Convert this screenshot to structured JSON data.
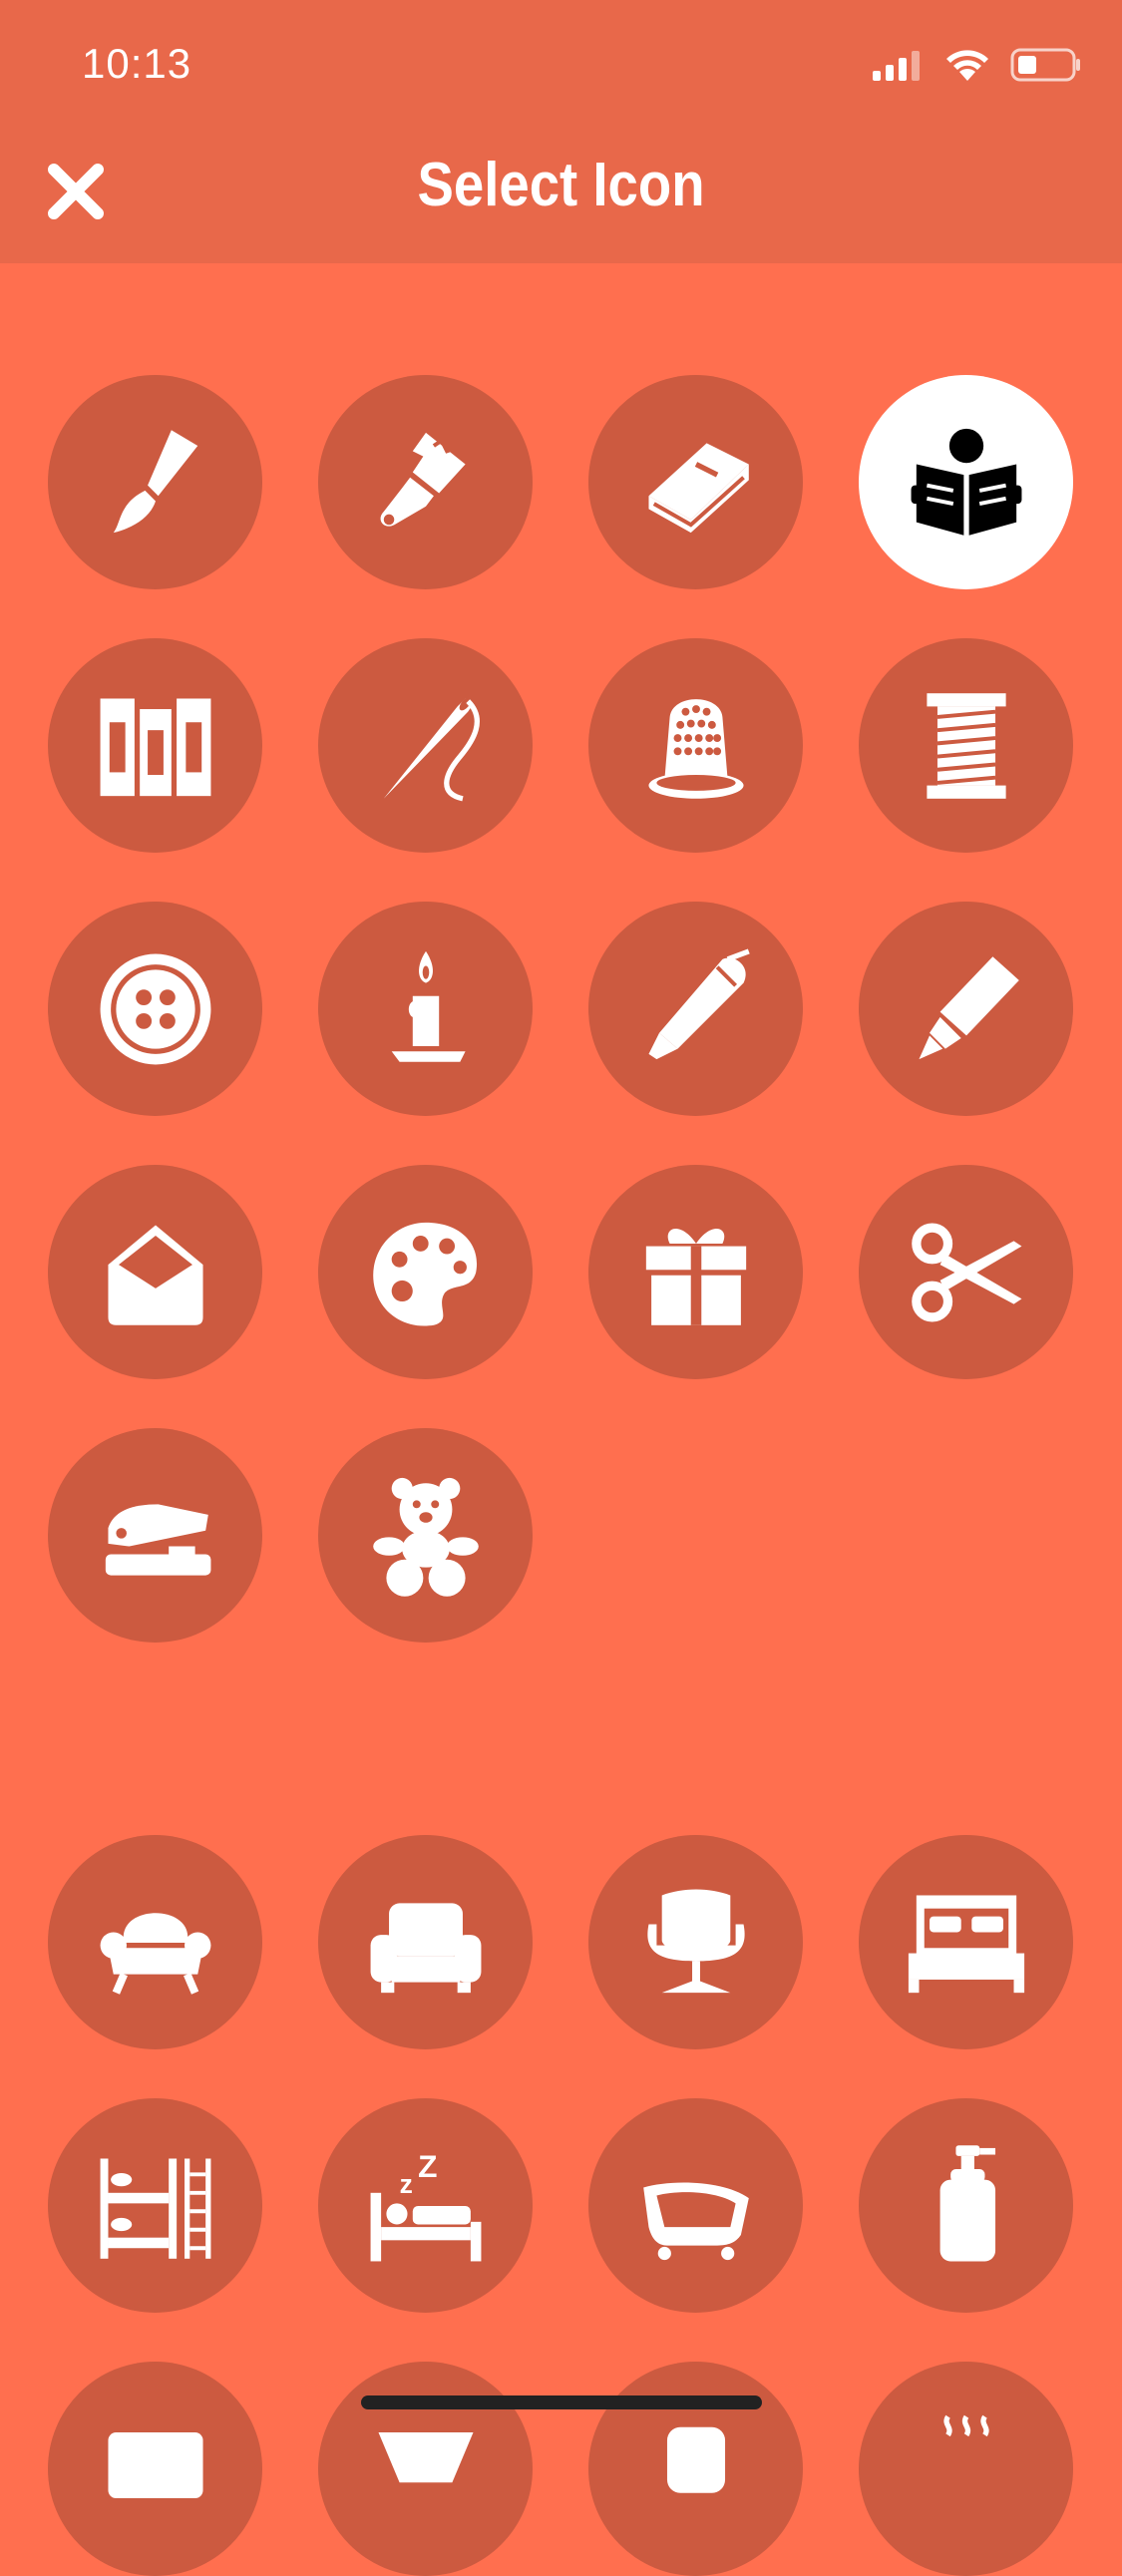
{
  "status_bar": {
    "time": "10:13"
  },
  "header": {
    "title": "Select Icon"
  },
  "icons_primary": [
    "paintbrush-icon",
    "paint-brush-wide-icon",
    "book-icon",
    "reading-person-icon",
    "books-icon",
    "needle-thread-icon",
    "thimble-icon",
    "thread-spool-icon",
    "button-icon",
    "candle-icon",
    "pen-icon",
    "highlighter-icon",
    "envelope-icon",
    "palette-icon",
    "gift-icon",
    "scissors-icon",
    "stapler-icon",
    "teddy-bear-icon"
  ],
  "selected_icon": "reading-person-icon",
  "icons_secondary": [
    "armchair-icon",
    "sofa-chair-icon",
    "swivel-chair-icon",
    "bed-icon",
    "bunk-bed-icon",
    "sleeping-bed-icon",
    "bathtub-icon",
    "soap-dispenser-icon",
    "partial-row-icon-1",
    "partial-row-icon-2",
    "partial-row-icon-3",
    "partial-row-icon-4"
  ],
  "colors": {
    "header": "#E8684A",
    "background": "#FF6F4F",
    "circle": "#CC5A40",
    "selected_circle": "#FFFFFF",
    "icon": "#FFFFFF",
    "selected_icon": "#000000"
  }
}
